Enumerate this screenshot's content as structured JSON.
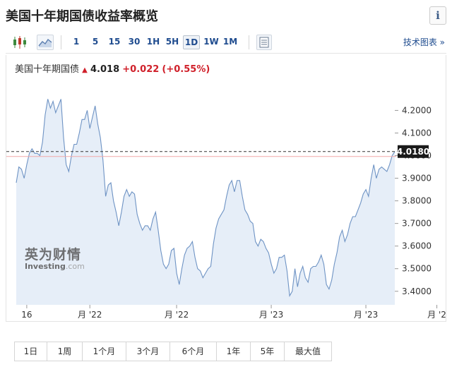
{
  "page": {
    "title": "美国十年期国债收益率概览",
    "info_label": "i"
  },
  "toolbar": {
    "candle_icon": "candlestick-icon",
    "area_icon": "area-chart-icon",
    "timeframes": [
      {
        "label": "1",
        "active": false
      },
      {
        "label": "5",
        "active": false
      },
      {
        "label": "15",
        "active": false
      },
      {
        "label": "30",
        "active": false
      },
      {
        "label": "1H",
        "active": false
      },
      {
        "label": "5H",
        "active": false
      },
      {
        "label": "1D",
        "active": true
      },
      {
        "label": "1W",
        "active": false
      },
      {
        "label": "1M",
        "active": false
      }
    ],
    "doc_icon": "document-icon",
    "tech_chart_label": "技术图表 »"
  },
  "legend": {
    "instrument": "美国十年期国债",
    "arrow": "▲",
    "price": "4.018",
    "change": "+0.022",
    "change_pct": "(+0.55%)"
  },
  "watermark": {
    "brand_cn": "英为财情",
    "brand_en": "Investing",
    "brand_suffix": ".com"
  },
  "colors": {
    "line": "#6e93c4",
    "fill": "#e6eef8",
    "up": "#d0202a",
    "link": "#1f4c8f",
    "price_tag_bg": "#1a1a1a",
    "ref_line": "#f2a9a9"
  },
  "chart_data": {
    "type": "area",
    "series": [
      {
        "name": "美国十年期国债",
        "values": [
          3.88,
          3.95,
          3.94,
          3.9,
          3.96,
          4.01,
          4.03,
          4.01,
          4.01,
          4.0,
          4.06,
          4.18,
          4.25,
          4.21,
          4.24,
          4.19,
          4.22,
          4.25,
          4.08,
          3.96,
          3.93,
          4.0,
          4.05,
          4.05,
          4.1,
          4.16,
          4.16,
          4.2,
          4.12,
          4.17,
          4.22,
          4.14,
          4.08,
          3.98,
          3.82,
          3.87,
          3.88,
          3.8,
          3.75,
          3.69,
          3.75,
          3.82,
          3.85,
          3.82,
          3.84,
          3.83,
          3.74,
          3.7,
          3.67,
          3.69,
          3.69,
          3.67,
          3.72,
          3.75,
          3.67,
          3.58,
          3.52,
          3.5,
          3.52,
          3.58,
          3.59,
          3.48,
          3.43,
          3.5,
          3.56,
          3.59,
          3.6,
          3.62,
          3.55,
          3.5,
          3.49,
          3.46,
          3.48,
          3.5,
          3.51,
          3.61,
          3.68,
          3.72,
          3.74,
          3.76,
          3.82,
          3.87,
          3.89,
          3.84,
          3.89,
          3.89,
          3.82,
          3.76,
          3.74,
          3.71,
          3.7,
          3.62,
          3.6,
          3.63,
          3.62,
          3.59,
          3.57,
          3.52,
          3.48,
          3.5,
          3.55,
          3.55,
          3.56,
          3.49,
          3.38,
          3.4,
          3.5,
          3.42,
          3.48,
          3.51,
          3.46,
          3.44,
          3.5,
          3.51,
          3.51,
          3.53,
          3.56,
          3.52,
          3.43,
          3.41,
          3.45,
          3.52,
          3.57,
          3.64,
          3.67,
          3.62,
          3.65,
          3.7,
          3.73,
          3.73,
          3.76,
          3.79,
          3.83,
          3.85,
          3.82,
          3.9,
          3.96,
          3.9,
          3.94,
          3.95,
          3.94,
          3.93,
          3.96,
          4.0,
          4.018
        ]
      }
    ],
    "x_tick_labels": [
      "16",
      "月 '22",
      "月 '22",
      "月 '23",
      "月 '23",
      "月 '2"
    ],
    "x_tick_index": [
      4,
      28,
      61,
      97,
      133,
      160
    ],
    "y_ticks": [
      3.4,
      3.5,
      3.6,
      3.7,
      3.8,
      3.9,
      4.0,
      4.1,
      4.2
    ],
    "y_tick_labels": [
      "3.4000",
      "3.5000",
      "3.6000",
      "3.7000",
      "3.8000",
      "3.9000",
      "4.0000",
      "4.1000",
      "4.2000"
    ],
    "ylim": [
      3.34,
      4.32
    ],
    "current_value": 4.018,
    "current_label": "4.0180",
    "reference_value": 3.996,
    "grid": false,
    "legend": "top-left"
  },
  "ranges": [
    "1日",
    "1周",
    "1个月",
    "3个月",
    "6个月",
    "1年",
    "5年",
    "最大值"
  ]
}
